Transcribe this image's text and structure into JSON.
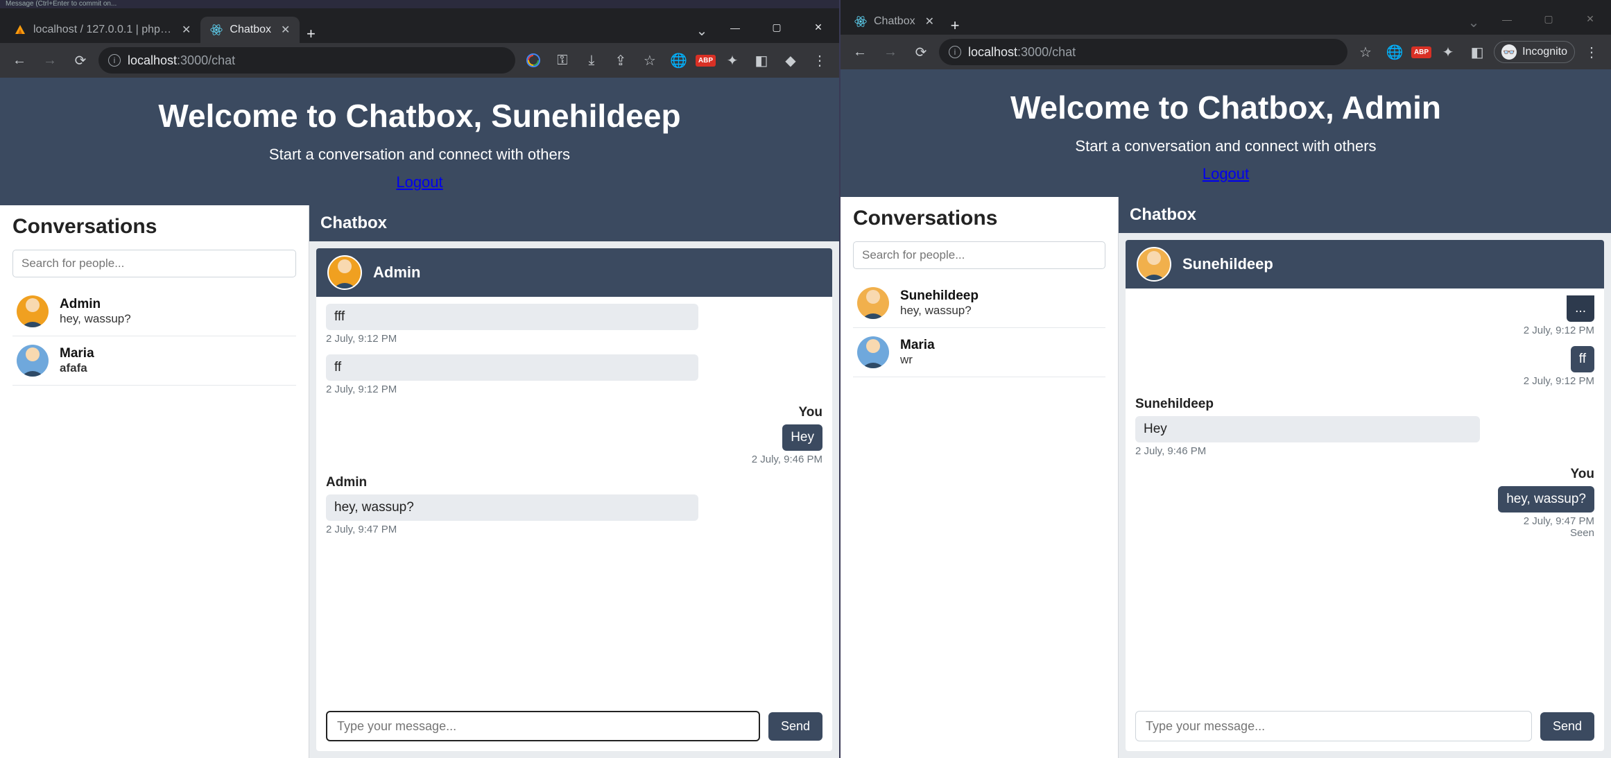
{
  "leftWindow": {
    "titlebarHint": "Message (Ctrl+Enter to commit on...",
    "tabs": [
      {
        "title": "localhost / 127.0.0.1 | phpMyAd...",
        "active": false,
        "favicon": "phpmyadmin"
      },
      {
        "title": "Chatbox",
        "active": true,
        "favicon": "react"
      }
    ],
    "url": {
      "host": "localhost",
      "rest": ":3000/chat"
    },
    "hero": {
      "title": "Welcome to Chatbox, Sunehildeep",
      "subtitle": "Start a conversation and connect with others",
      "logout": "Logout"
    },
    "sidebar": {
      "heading": "Conversations",
      "searchPlaceholder": "Search for people...",
      "items": [
        {
          "name": "Admin",
          "last": "hey, wassup?",
          "bold": false,
          "avatar": "orange"
        },
        {
          "name": "Maria",
          "last": "afafa",
          "bold": true,
          "avatar": "blue"
        }
      ]
    },
    "chat": {
      "panelTitle": "Chatbox",
      "peer": "Admin",
      "peerAvatar": "orange",
      "groups": [
        {
          "side": "left",
          "sender": "",
          "bubble": "fff",
          "time": "2 July, 9:12 PM",
          "style": "in"
        },
        {
          "side": "left",
          "sender": "",
          "bubble": "ff",
          "time": "2 July, 9:12 PM",
          "style": "in"
        },
        {
          "side": "right",
          "sender": "You",
          "bubble": "Hey",
          "time": "2 July, 9:46 PM",
          "style": "out"
        },
        {
          "side": "left",
          "sender": "Admin",
          "bubble": "hey, wassup?",
          "time": "2 July, 9:47 PM",
          "style": "in"
        }
      ],
      "composerPlaceholder": "Type your message...",
      "sendLabel": "Send",
      "composerFocused": true
    }
  },
  "rightWindow": {
    "tabs": [
      {
        "title": "Chatbox",
        "active": false,
        "favicon": "react"
      }
    ],
    "url": {
      "host": "localhost",
      "rest": ":3000/chat"
    },
    "incognitoLabel": "Incognito",
    "hero": {
      "title": "Welcome to Chatbox, Admin",
      "subtitle": "Start a conversation and connect with others",
      "logout": "Logout"
    },
    "sidebar": {
      "heading": "Conversations",
      "searchPlaceholder": "Search for people...",
      "items": [
        {
          "name": "Sunehildeep",
          "last": "hey, wassup?",
          "bold": false,
          "avatar": "orange2"
        },
        {
          "name": "Maria",
          "last": "wr",
          "bold": false,
          "avatar": "blue"
        }
      ]
    },
    "chat": {
      "panelTitle": "Chatbox",
      "peer": "Sunehildeep",
      "peerAvatar": "orange2",
      "partialTop": {
        "bubble": "...",
        "time": "2 July, 9:12 PM"
      },
      "groups": [
        {
          "side": "right",
          "sender": "",
          "bubble": "ff",
          "time": "2 July, 9:12 PM",
          "style": "out"
        },
        {
          "side": "left",
          "sender": "Sunehildeep",
          "bubble": "Hey",
          "time": "2 July, 9:46 PM",
          "style": "in"
        },
        {
          "side": "right",
          "sender": "You",
          "bubble": "hey, wassup?",
          "time": "2 July, 9:47 PM",
          "style": "out",
          "seen": "Seen"
        }
      ],
      "composerPlaceholder": "Type your message...",
      "sendLabel": "Send",
      "composerFocused": false
    }
  }
}
